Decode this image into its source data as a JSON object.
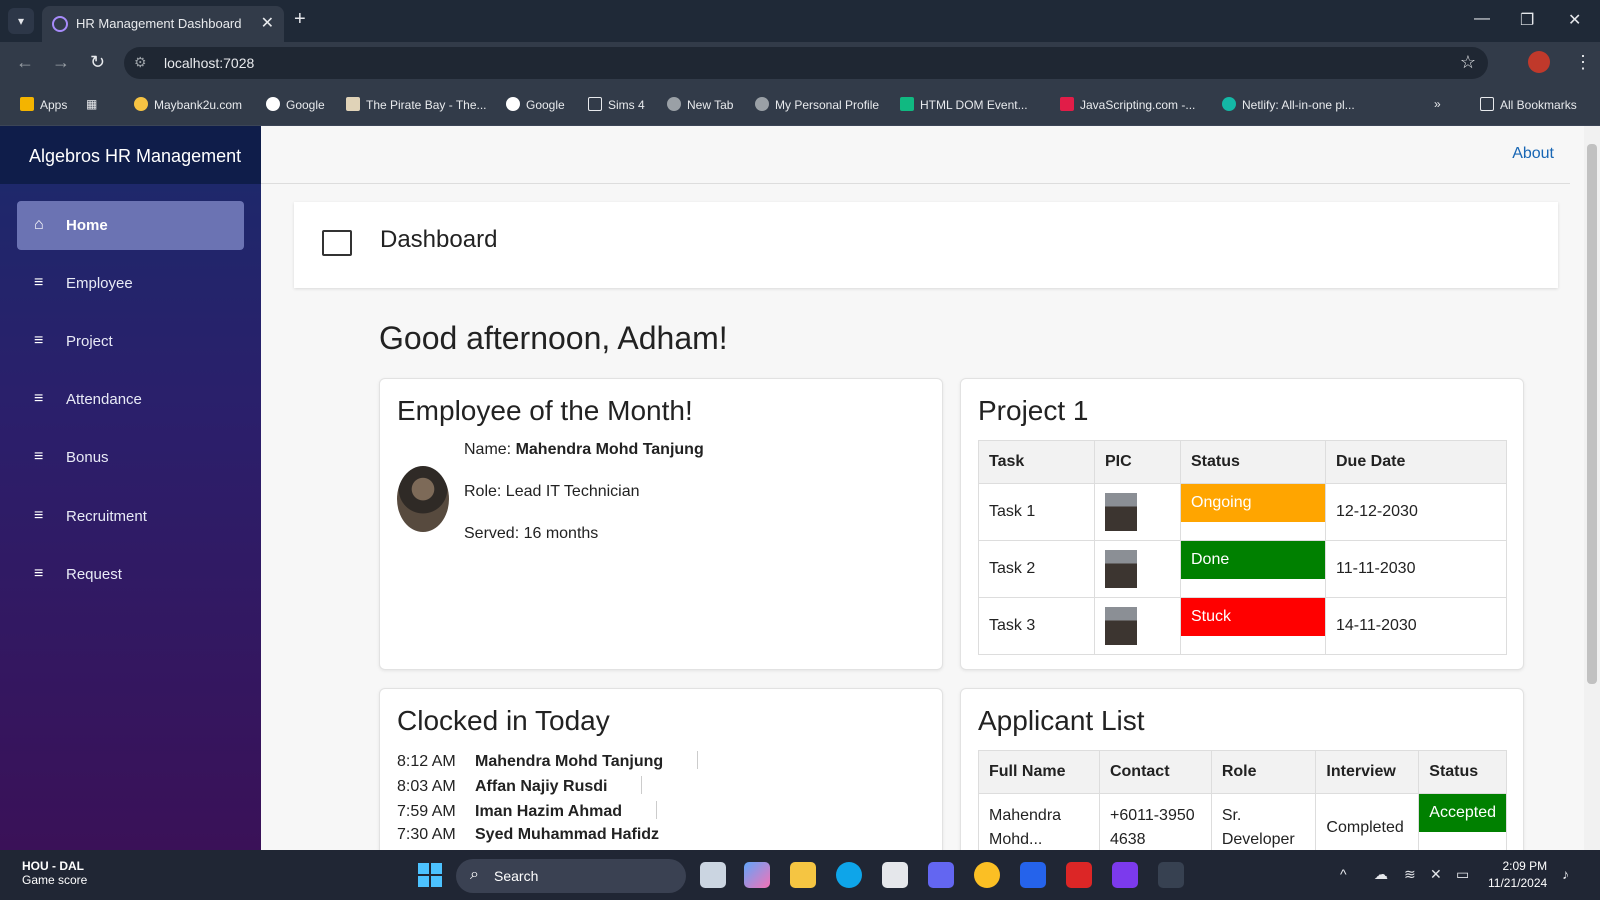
{
  "browser": {
    "tab_title": "HR Management Dashboard",
    "url": "localhost:7028",
    "bookmarks": [
      "Apps",
      "Maybank2u.com",
      "Google",
      "The Pirate Bay - The...",
      "Google",
      "Sims 4",
      "New Tab",
      "My Personal Profile",
      "HTML DOM Event...",
      "JavaScripting.com -...",
      "Netlify: All-in-one pl..."
    ],
    "all_bookmarks": "All Bookmarks"
  },
  "app": {
    "brand": "Algebros HR Management",
    "about": "About",
    "page_title": "Dashboard",
    "greeting": "Good afternoon, Adham!",
    "nav": [
      "Home",
      "Employee",
      "Project",
      "Attendance",
      "Bonus",
      "Recruitment",
      "Request"
    ]
  },
  "eom": {
    "title": "Employee of the Month!",
    "name_label": "Name: ",
    "name": "Mahendra Mohd Tanjung",
    "role": "Role: Lead IT Technician",
    "served": "Served: 16 months"
  },
  "project": {
    "title": "Project 1",
    "headers": [
      "Task",
      "PIC",
      "Status",
      "Due Date"
    ],
    "rows": [
      {
        "task": "Task 1",
        "status": "Ongoing",
        "color": "#ffa500",
        "due": "12-12-2030"
      },
      {
        "task": "Task 2",
        "status": "Done",
        "color": "#008000",
        "due": "11-11-2030"
      },
      {
        "task": "Task 3",
        "status": "Stuck",
        "color": "#ff0000",
        "due": "14-11-2030"
      }
    ]
  },
  "clocked": {
    "title": "Clocked in Today",
    "rows": [
      {
        "time": "8:12 AM",
        "name": "Mahendra Mohd Tanjung"
      },
      {
        "time": "8:03 AM",
        "name": "Affan Najiy Rusdi"
      },
      {
        "time": "7:59 AM",
        "name": "Iman Hazim Ahmad"
      },
      {
        "time": "7:30 AM",
        "name": "Syed Muhammad Hafidz"
      }
    ]
  },
  "applicants": {
    "title": "Applicant List",
    "headers": [
      "Full Name",
      "Contact",
      "Role",
      "Interview",
      "Status"
    ],
    "rows": [
      {
        "name_1": "Mahendra",
        "name_2": "Mohd...",
        "contact_1": "+6011-3950",
        "contact_2": "4638",
        "role_1": "Sr.",
        "role_2": "Developer",
        "interview": "Completed",
        "status": "Accepted",
        "color": "#008000"
      }
    ]
  },
  "taskbar": {
    "game_team": "HOU - DAL",
    "game_sub": "Game score",
    "search": "Search",
    "time": "2:09 PM",
    "date": "11/21/2024"
  }
}
